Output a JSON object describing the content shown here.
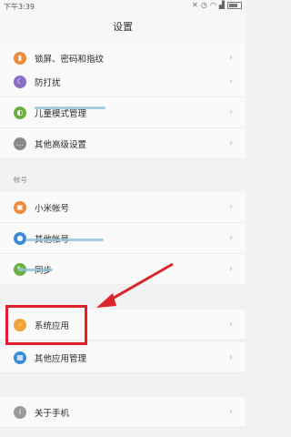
{
  "status_bar": {
    "time": "下午3:39"
  },
  "header": {
    "title": "设置"
  },
  "rows": [
    {
      "label": "锁屏、密码和指纹",
      "icon": "lock-icon",
      "color": "#f08a3a"
    },
    {
      "label": "防打扰",
      "icon": "moon-icon",
      "color": "#8a6fc7"
    },
    {
      "label": "儿童模式管理",
      "icon": "shield-icon",
      "color": "#6aaf43"
    },
    {
      "label": "其他高级设置",
      "icon": "more-icon",
      "color": "#8a8a8a"
    }
  ],
  "account_section": {
    "label": "帐号",
    "rows": [
      {
        "label": "小米帐号",
        "icon": "mi-account-icon",
        "color": "#f08a3a"
      },
      {
        "label": "其他帐号",
        "icon": "person-icon",
        "color": "#3b8ad6"
      },
      {
        "label": "同步",
        "icon": "sync-icon",
        "color": "#6aaf43"
      }
    ]
  },
  "apps_section": {
    "rows": [
      {
        "label": "系统应用",
        "icon": "apps-grid-icon",
        "color": "#f0a43a"
      },
      {
        "label": "其他应用管理",
        "icon": "apps-manage-icon",
        "color": "#3b8ad6"
      }
    ]
  },
  "about_section": {
    "rows": [
      {
        "label": "关于手机",
        "icon": "info-icon",
        "color": "#9a9a9a"
      }
    ]
  },
  "annotation": {
    "highlight_color": "#e0212b",
    "arrow_color": "#d9262c"
  }
}
